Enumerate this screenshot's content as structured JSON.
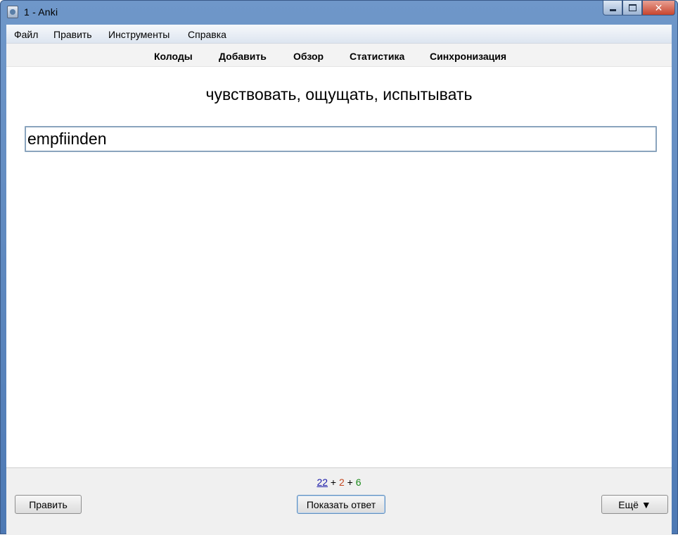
{
  "window": {
    "title": "1 - Anki",
    "controls": {
      "minimize": "",
      "maximize": "",
      "close": "✕"
    }
  },
  "menu": {
    "items": [
      {
        "label": "Файл"
      },
      {
        "label": "Править"
      },
      {
        "label": "Инструменты"
      },
      {
        "label": "Справка"
      }
    ]
  },
  "toolbar": {
    "links": [
      {
        "label": "Колоды"
      },
      {
        "label": "Добавить"
      },
      {
        "label": "Обзор"
      },
      {
        "label": "Статистика"
      },
      {
        "label": "Синхронизация"
      }
    ]
  },
  "card": {
    "question": "чувствовать, ощущать, испытывать",
    "answer_value": "empfiinden"
  },
  "bottom": {
    "counts": {
      "new": "22",
      "sep1": " + ",
      "learn": "2",
      "sep2": " + ",
      "review": "6"
    },
    "edit_label": "Править",
    "show_answer_label": "Показать ответ",
    "more_label": "Ещё ▼"
  },
  "colors": {
    "count_new": "#1b1ba8",
    "count_learn": "#c4461f",
    "count_review": "#1a8a1a",
    "titlebar": "#5b86bf"
  }
}
